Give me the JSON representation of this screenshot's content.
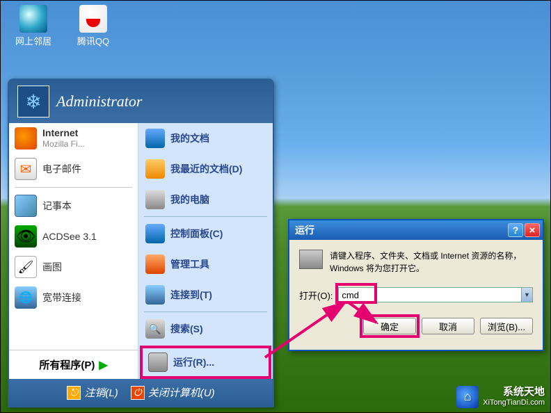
{
  "desktop": {
    "icons": [
      {
        "label": "网上邻居"
      },
      {
        "label": "腾讯QQ"
      }
    ]
  },
  "startmenu": {
    "user": "Administrator",
    "left": {
      "internet": {
        "title": "Internet",
        "sub": "Mozilla Fi..."
      },
      "email": "电子邮件",
      "notepad": "记事本",
      "acdsee": "ACDSee 3.1",
      "paint": "画图",
      "broadband": "宽带连接",
      "allprograms": "所有程序(P)"
    },
    "right": {
      "mydocs": "我的文档",
      "recent": "我最近的文档(D)",
      "mycomputer": "我的电脑",
      "control": "控制面板(C)",
      "admin": "管理工具",
      "connect": "连接到(T)",
      "search": "搜索(S)",
      "run": "运行(R)..."
    },
    "footer": {
      "logoff": "注销(L)",
      "shutdown": "关闭计算机(U)"
    }
  },
  "dialog": {
    "title": "运行",
    "message": "请键入程序、文件夹、文档或 Internet 资源的名称，Windows 将为您打开它。",
    "open_label": "打开(O):",
    "input_value": "cmd",
    "ok": "确定",
    "cancel": "取消",
    "browse": "浏览(B)..."
  },
  "watermark": {
    "line1": "系统天地",
    "line2": "XiTongTianDi.com"
  }
}
